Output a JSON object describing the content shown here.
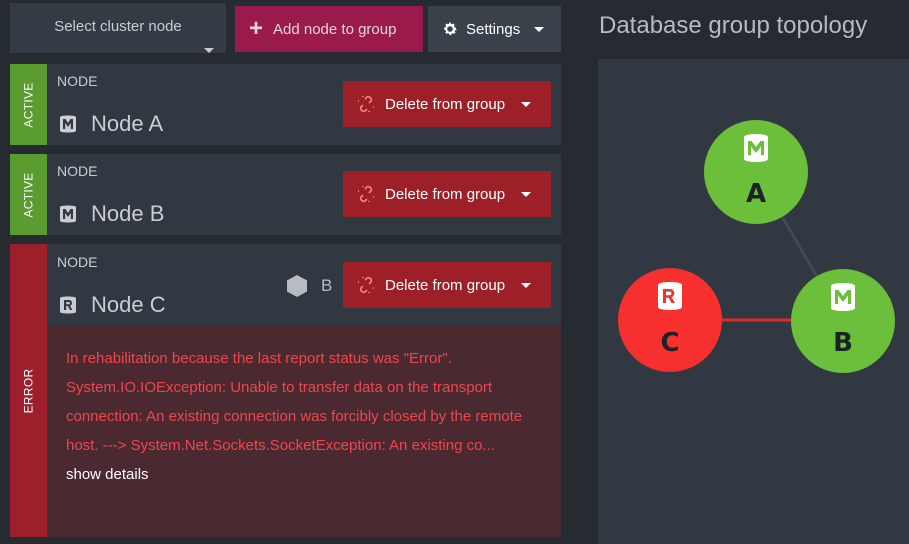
{
  "toolbar": {
    "select_node_label": "Select cluster node",
    "add_node_label": "Add node to group",
    "settings_label": "Settings"
  },
  "nodes": [
    {
      "status": "ACTIVE",
      "label": "NODE",
      "name": "Node A",
      "type_icon": "member-db-icon",
      "delete_label": "Delete from group",
      "status_color": "#5a9c2f"
    },
    {
      "status": "ACTIVE",
      "label": "NODE",
      "name": "Node B",
      "type_icon": "member-db-icon",
      "delete_label": "Delete from group",
      "status_color": "#5a9c2f"
    },
    {
      "status": "ERROR",
      "label": "NODE",
      "name": "Node C",
      "type_icon": "rehab-db-icon",
      "tag": "B",
      "delete_label": "Delete from group",
      "status_color": "#9c1f2b",
      "error_message": "In rehabilitation because the last report status was \"Error\". System.IO.IOException: Unable to transfer data on the transport connection: An existing connection was forcibly closed by the remote host. ---> System.Net.Sockets.SocketException: An existing co...",
      "show_details_label": "show details"
    }
  ],
  "topology": {
    "title": "Database group topology",
    "nodes": [
      {
        "letter": "A",
        "role": "M",
        "color": "#6cbf3a"
      },
      {
        "letter": "B",
        "role": "M",
        "color": "#6cbf3a"
      },
      {
        "letter": "C",
        "role": "R",
        "color": "#f5302f"
      }
    ]
  }
}
